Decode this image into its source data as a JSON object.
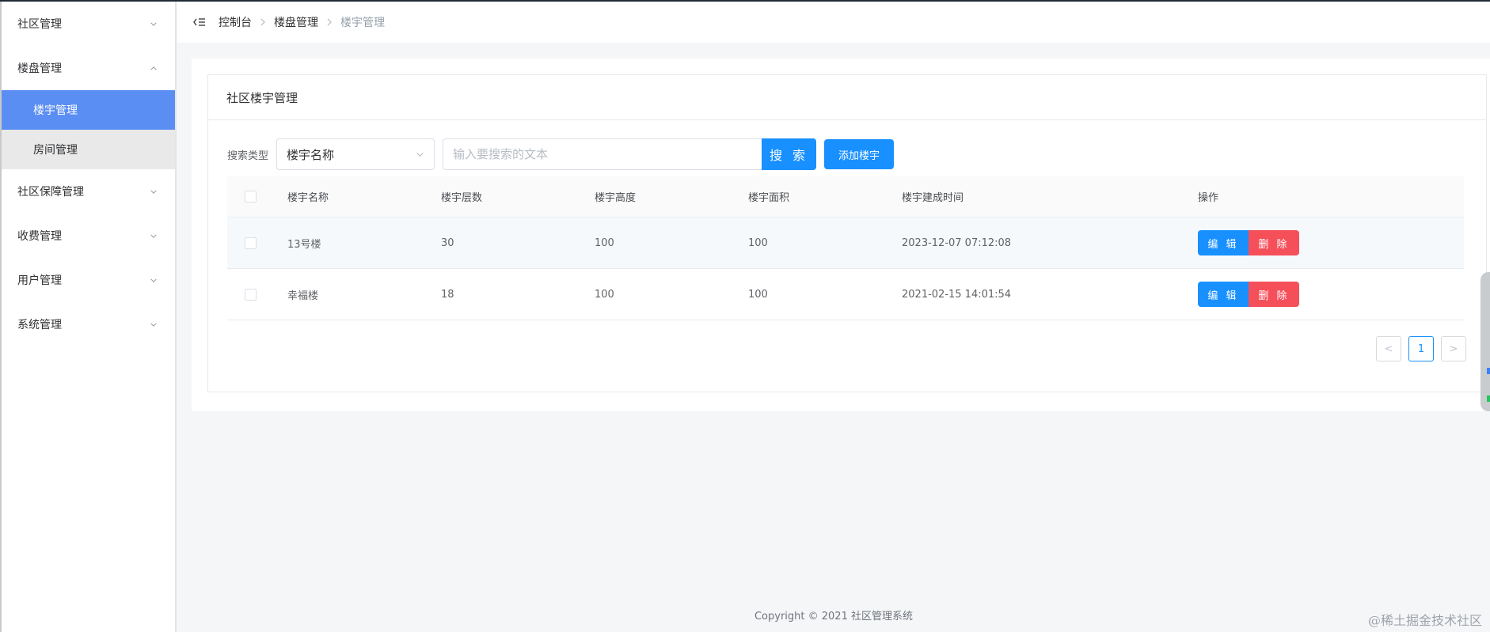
{
  "sidebar": {
    "items": [
      {
        "label": "社区管理",
        "expanded": false
      },
      {
        "label": "楼盘管理",
        "expanded": true,
        "children": [
          {
            "label": "楼宇管理",
            "active": true
          },
          {
            "label": "房间管理",
            "active": false
          }
        ]
      },
      {
        "label": "社区保障管理",
        "expanded": false
      },
      {
        "label": "收费管理",
        "expanded": false
      },
      {
        "label": "用户管理",
        "expanded": false
      },
      {
        "label": "系统管理",
        "expanded": false
      }
    ]
  },
  "breadcrumb": [
    "控制台",
    "楼盘管理",
    "楼宇管理"
  ],
  "panel": {
    "title": "社区楼宇管理"
  },
  "search": {
    "label": "搜索类型",
    "select_value": "楼宇名称",
    "placeholder": "输入要搜索的文本",
    "value": "",
    "search_button": "搜 索",
    "add_button": "添加楼宇"
  },
  "table": {
    "headers": [
      "楼宇名称",
      "楼宇层数",
      "楼宇高度",
      "楼宇面积",
      "楼宇建成时间",
      "操作"
    ],
    "rows": [
      {
        "name": "13号楼",
        "floors": "30",
        "height": "100",
        "area": "100",
        "built": "2023-12-07 07:12:08"
      },
      {
        "name": "幸福楼",
        "floors": "18",
        "height": "100",
        "area": "100",
        "built": "2021-02-15 14:01:54"
      }
    ],
    "edit_label": "编 辑",
    "delete_label": "删 除"
  },
  "pagination": {
    "current": "1",
    "prev": "<",
    "next": ">"
  },
  "footer": {
    "copyright": "Copyright © 2021 社区管理系统",
    "watermark": "@稀土掘金技术社区"
  },
  "colors": {
    "primary": "#1890ff",
    "danger": "#f5505a",
    "sidebar_active": "#5a8ef2"
  }
}
